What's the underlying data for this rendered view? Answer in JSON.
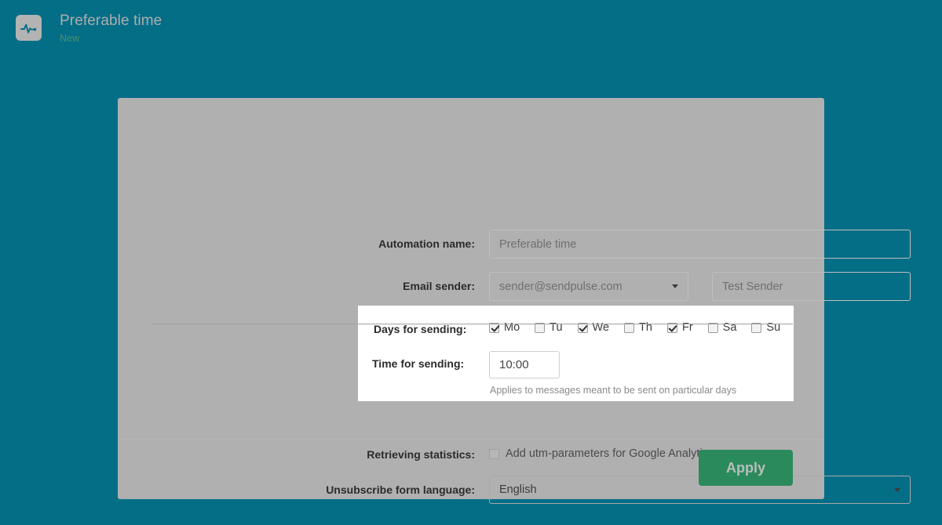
{
  "header": {
    "icon": "pulse-icon",
    "title": "Preferable time",
    "status": "New"
  },
  "form": {
    "automation_name": {
      "label": "Automation name:",
      "value": "",
      "placeholder": "Preferable time"
    },
    "email_sender": {
      "label": "Email sender:",
      "selected": "sender@sendpulse.com"
    },
    "test_sender": {
      "value": "",
      "placeholder": "Test Sender"
    },
    "days_for_sending": {
      "label": "Days for sending:",
      "days": [
        {
          "label": "Mo",
          "checked": true
        },
        {
          "label": "Tu",
          "checked": false
        },
        {
          "label": "We",
          "checked": true
        },
        {
          "label": "Th",
          "checked": false
        },
        {
          "label": "Fr",
          "checked": true
        },
        {
          "label": "Sa",
          "checked": false
        },
        {
          "label": "Su",
          "checked": false
        }
      ]
    },
    "time_for_sending": {
      "label": "Time for sending:",
      "value": "10:00",
      "hint": "Applies to messages meant to be sent on particular days"
    },
    "retrieving_statistics": {
      "label": "Retrieving statistics:",
      "checkbox_label": "Add utm-parameters for Google Analytics",
      "checked": false
    },
    "unsubscribe_language": {
      "label": "Unsubscribe form language:",
      "selected": "English"
    }
  },
  "footer": {
    "apply_label": "Apply"
  },
  "colors": {
    "page_background": "#046e87",
    "card_background": "#b0b0b0",
    "highlight_panel": "#ffffff",
    "apply_button": "#2b8a5c",
    "status_text": "#4a8f72"
  }
}
